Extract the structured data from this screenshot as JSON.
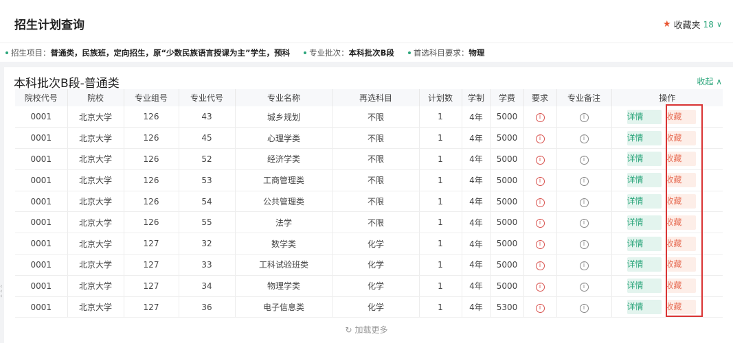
{
  "header": {
    "title": "招生计划查询",
    "favorites_label": "收藏夹",
    "favorites_count": "18"
  },
  "filters": [
    {
      "key": "招生项目：",
      "value": "普通类，民族班，定向招生，原“少数民族语言授课为主”学生，预科"
    },
    {
      "key": "专业批次：",
      "value": "本科批次B段"
    },
    {
      "key": "首选科目要求：",
      "value": "物理"
    }
  ],
  "section": {
    "title": "本科批次B段-普通类",
    "collapse_label": "收起"
  },
  "table": {
    "columns": [
      "院校代号",
      "院校",
      "专业组号",
      "专业代号",
      "专业名称",
      "再选科目",
      "计划数",
      "学制",
      "学费",
      "要求",
      "专业备注",
      "操作"
    ],
    "rows": [
      [
        "0001",
        "北京大学",
        "126",
        "43",
        "城乡规划",
        "不限",
        "1",
        "4年",
        "5000"
      ],
      [
        "0001",
        "北京大学",
        "126",
        "45",
        "心理学类",
        "不限",
        "1",
        "4年",
        "5000"
      ],
      [
        "0001",
        "北京大学",
        "126",
        "52",
        "经济学类",
        "不限",
        "1",
        "4年",
        "5000"
      ],
      [
        "0001",
        "北京大学",
        "126",
        "53",
        "工商管理类",
        "不限",
        "1",
        "4年",
        "5000"
      ],
      [
        "0001",
        "北京大学",
        "126",
        "54",
        "公共管理类",
        "不限",
        "1",
        "4年",
        "5000"
      ],
      [
        "0001",
        "北京大学",
        "126",
        "55",
        "法学",
        "不限",
        "1",
        "4年",
        "5000"
      ],
      [
        "0001",
        "北京大学",
        "127",
        "32",
        "数学类",
        "化学",
        "1",
        "4年",
        "5000"
      ],
      [
        "0001",
        "北京大学",
        "127",
        "33",
        "工科试验班类",
        "化学",
        "1",
        "4年",
        "5000"
      ],
      [
        "0001",
        "北京大学",
        "127",
        "34",
        "物理学类",
        "化学",
        "1",
        "4年",
        "5000"
      ],
      [
        "0001",
        "北京大学",
        "127",
        "36",
        "电子信息类",
        "化学",
        "1",
        "4年",
        "5300"
      ]
    ],
    "detail_label": "详情",
    "fav_label": "收藏"
  },
  "load_more_label": "加载更多",
  "colors": {
    "accent": "#2aa57a",
    "fav": "#e8725a",
    "highlight_border": "#d93333"
  }
}
